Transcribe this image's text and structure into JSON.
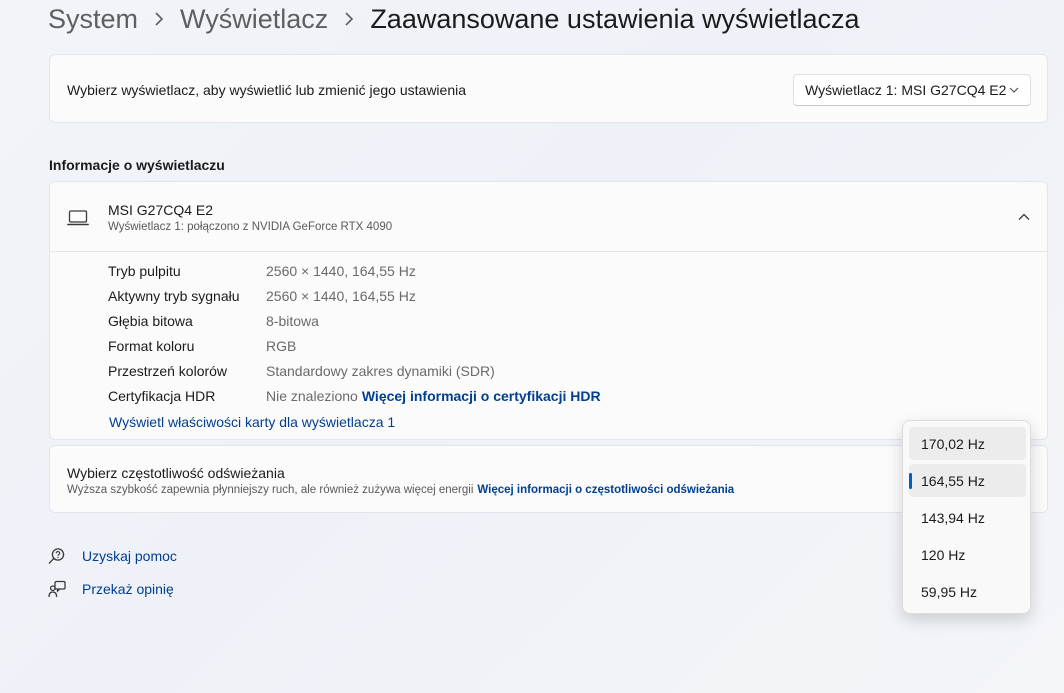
{
  "breadcrumb": {
    "items": [
      "System",
      "Wyświetlacz"
    ],
    "current": "Zaawansowane ustawienia wyświetlacza"
  },
  "display_select": {
    "label": "Wybierz wyświetlacz, aby wyświetlić lub zmienić jego ustawienia",
    "selected": "Wyświetlacz 1: MSI G27CQ4 E2"
  },
  "info_section": {
    "title": "Informacje o wyświetlaczu",
    "name": "MSI G27CQ4 E2",
    "subtitle": "Wyświetlacz 1: połączono z NVIDIA GeForce RTX 4090",
    "rows": [
      {
        "label": "Tryb pulpitu",
        "value": "2560 × 1440, 164,55 Hz"
      },
      {
        "label": "Aktywny tryb sygnału",
        "value": "2560 × 1440, 164,55 Hz"
      },
      {
        "label": "Głębia bitowa",
        "value": "8-bitowa"
      },
      {
        "label": "Format koloru",
        "value": "RGB"
      },
      {
        "label": "Przestrzeń kolorów",
        "value": "Standardowy zakres dynamiki (SDR)"
      },
      {
        "label": "Certyfikacja HDR",
        "value": "Nie znaleziono",
        "link": "Więcej informacji o certyfikacji HDR"
      }
    ],
    "adapter_link": "Wyświetl właściwości karty dla wyświetlacza 1"
  },
  "refresh": {
    "title": "Wybierz częstotliwość odświeżania",
    "description": "Wyższa szybkość zapewnia płynniejszy ruch, ale również zużywa więcej energii",
    "link": "Więcej informacji o częstotliwości odświeżania",
    "options": [
      "170,02 Hz",
      "164,55 Hz",
      "143,94 Hz",
      "120 Hz",
      "59,95 Hz"
    ],
    "selected": "164,55 Hz"
  },
  "footer": {
    "help": "Uzyskaj pomoc",
    "feedback": "Przekaż opinię"
  },
  "colors": {
    "accent": "#005fb8",
    "link": "#003e92"
  }
}
